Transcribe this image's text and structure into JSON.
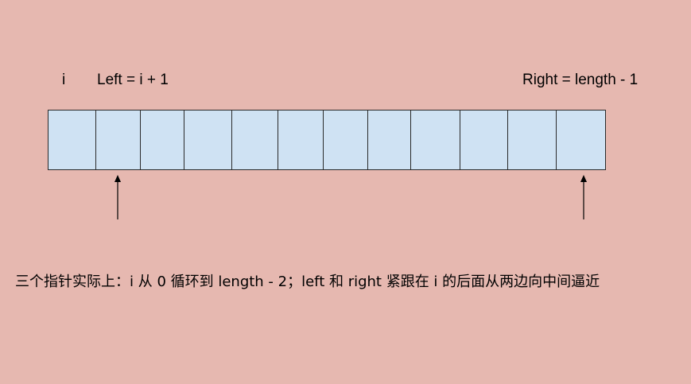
{
  "labels": {
    "i": "i",
    "left": "Left = i + 1",
    "right": "Right = length - 1"
  },
  "array": {
    "cell_count": 12,
    "cell_color": "#cfe2f3",
    "border_color": "#2a2a2a"
  },
  "arrows": {
    "color": "#000000",
    "pointing": [
      "left",
      "right"
    ]
  },
  "caption": "三个指针实际上：i 从 0 循环到 length - 2；left 和 right 紧跟在 i 的后面从两边向中间逼近",
  "background_color": "#e6b8b0"
}
